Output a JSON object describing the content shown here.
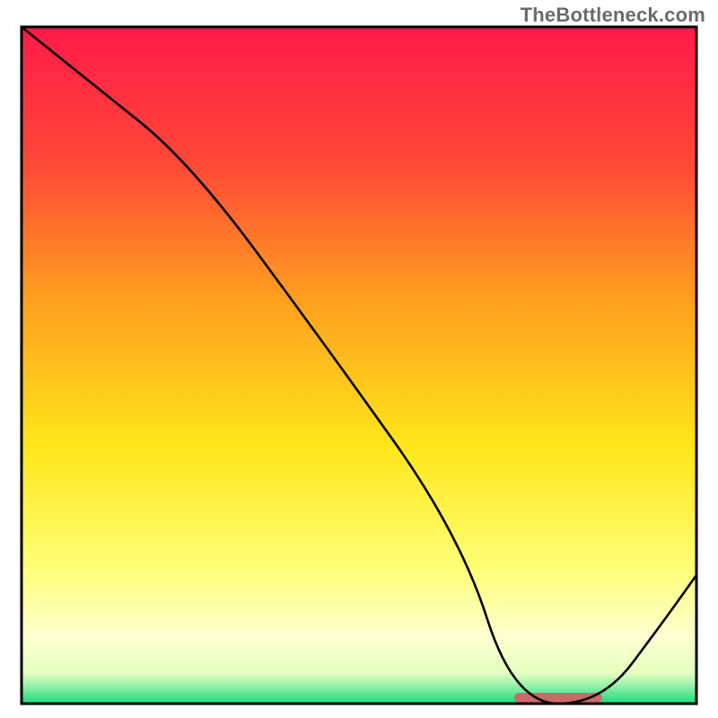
{
  "watermark": "TheBottleneck.com",
  "chart_data": {
    "type": "line",
    "title": "",
    "xlabel": "",
    "ylabel": "",
    "xlim": [
      0,
      100
    ],
    "ylim": [
      0,
      100
    ],
    "grid": false,
    "annotations": [
      {
        "type": "bar",
        "x_range": [
          73,
          86
        ],
        "y": 0,
        "color": "#c96a68"
      }
    ],
    "series": [
      {
        "name": "bottleneck-curve",
        "color": "#000000",
        "x": [
          0,
          10,
          25,
          45,
          65,
          73,
          86,
          95,
          100
        ],
        "values": [
          100,
          92,
          80,
          53,
          25,
          0,
          0,
          12,
          19
        ]
      }
    ],
    "background_gradient": {
      "type": "vertical",
      "stops": [
        {
          "offset": 0.0,
          "color": "#ff1a49"
        },
        {
          "offset": 0.2,
          "color": "#ff4837"
        },
        {
          "offset": 0.4,
          "color": "#ff9e1f"
        },
        {
          "offset": 0.62,
          "color": "#ffe61a"
        },
        {
          "offset": 0.8,
          "color": "#ffff77"
        },
        {
          "offset": 0.9,
          "color": "#ffffd0"
        },
        {
          "offset": 0.955,
          "color": "#e4ffbf"
        },
        {
          "offset": 0.975,
          "color": "#8df0a6"
        },
        {
          "offset": 1.0,
          "color": "#1bd97e"
        }
      ]
    },
    "colors": {
      "line": "#000000",
      "marker": "#c96a68",
      "border": "#000000"
    }
  }
}
